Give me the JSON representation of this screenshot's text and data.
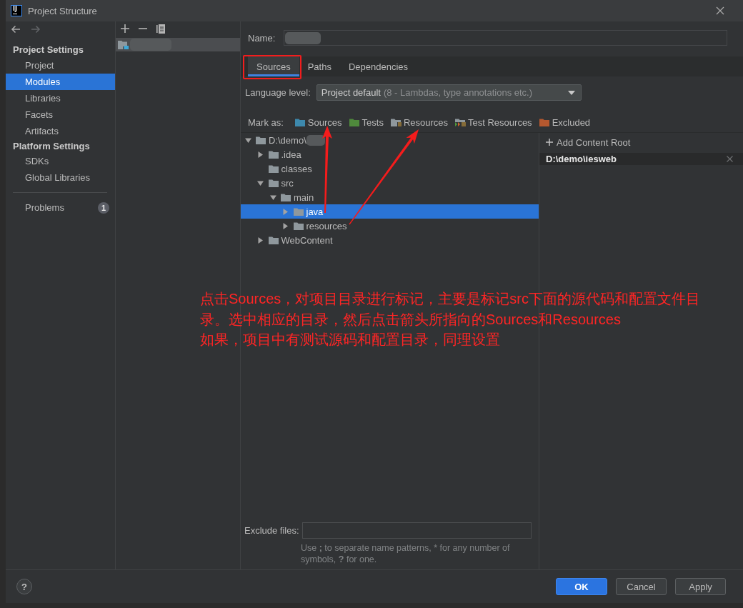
{
  "window": {
    "logo_text": "IJ",
    "title": "Project Structure"
  },
  "navigation": [
    {
      "kind": "back",
      "disabled": false
    },
    {
      "kind": "forward",
      "disabled": true
    }
  ],
  "sidebar": {
    "sections": [
      {
        "heading": "Project Settings",
        "items": [
          {
            "label": "Project",
            "selected": false
          },
          {
            "label": "Modules",
            "selected": true
          },
          {
            "label": "Libraries",
            "selected": false
          },
          {
            "label": "Facets",
            "selected": false
          },
          {
            "label": "Artifacts",
            "selected": false
          }
        ]
      },
      {
        "heading": "Platform Settings",
        "items": [
          {
            "label": "SDKs",
            "selected": false
          },
          {
            "label": "Global Libraries",
            "selected": false
          }
        ]
      }
    ],
    "problems": {
      "label": "Problems",
      "count": "1",
      "selected": false
    }
  },
  "module_list": {
    "items": [
      {
        "selected": true,
        "obscured": true
      }
    ]
  },
  "name_field": {
    "label": "Name:",
    "obscured": true
  },
  "tabs": [
    {
      "label": "Sources",
      "selected": true
    },
    {
      "label": "Paths",
      "selected": false
    },
    {
      "label": "Dependencies",
      "selected": false
    }
  ],
  "language_level": {
    "label": "Language level:",
    "value": "Project default",
    "detail": "(8 - Lambdas, type annotations etc.)"
  },
  "mark_as": {
    "label": "Mark as:",
    "items": [
      {
        "kind": "sources",
        "label": "Sources"
      },
      {
        "kind": "tests",
        "label": "Tests"
      },
      {
        "kind": "resources",
        "label": "Resources"
      },
      {
        "kind": "test_resources",
        "label": "Test Resources"
      },
      {
        "kind": "excluded",
        "label": "Excluded"
      }
    ]
  },
  "tree": {
    "nodes": [
      {
        "kind": "branch",
        "label": "D:\\demo\\",
        "obscured": true,
        "expanded": true,
        "selected": false,
        "children": [
          {
            "kind": "branch",
            "label": ".idea",
            "expanded": false,
            "selected": false
          },
          {
            "kind": "leaf",
            "label": "classes",
            "selected": false
          },
          {
            "kind": "branch",
            "label": "src",
            "expanded": true,
            "selected": false,
            "children": [
              {
                "kind": "branch",
                "label": "main",
                "expanded": true,
                "selected": false,
                "children": [
                  {
                    "kind": "branch",
                    "label": "java",
                    "expanded": false,
                    "selected": true
                  },
                  {
                    "kind": "branch",
                    "label": "resources",
                    "expanded": false,
                    "selected": false
                  }
                ]
              }
            ]
          },
          {
            "kind": "branch",
            "label": "WebContent",
            "expanded": false,
            "selected": false
          }
        ]
      }
    ]
  },
  "content_roots": {
    "add_label": "Add Content Root",
    "roots": [
      {
        "path": "D:\\demo\\iesweb"
      }
    ]
  },
  "exclude_files": {
    "label": "Exclude files:",
    "hint": "Use **;** to separate name patterns, * for any number of symbols, **?** for one."
  },
  "footer": {
    "help": "?",
    "buttons": [
      {
        "kind": "primary",
        "label": "OK"
      },
      {
        "kind": "secondary",
        "label": "Cancel"
      },
      {
        "kind": "secondary",
        "label": "Apply"
      }
    ]
  },
  "annotation": {
    "paragraphs": [
      "点击Sources，对项目目录进行标记，主要是标记src下面的源代码和配置文件目录。选中相应的目录，然后点击箭头所指向的Sources和Resources",
      "如果，项目中有测试源码和配置目录，同理设置"
    ]
  }
}
